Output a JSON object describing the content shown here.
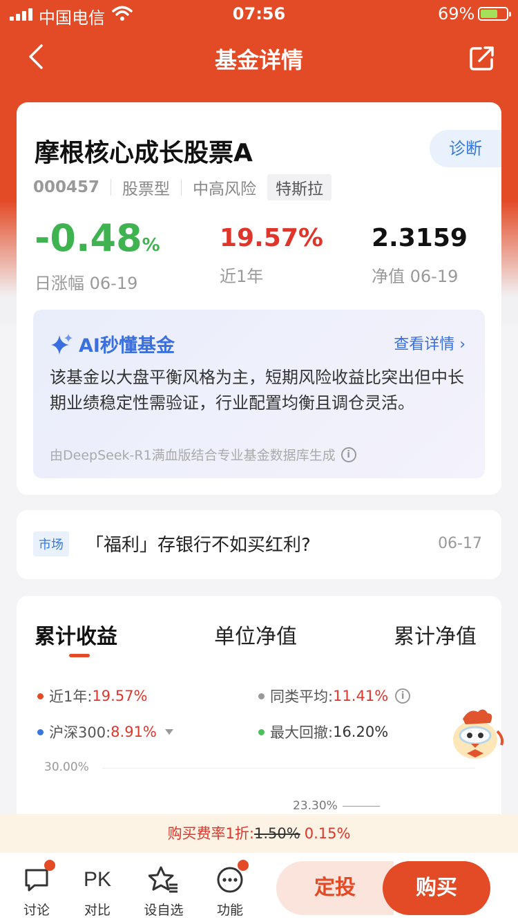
{
  "status": {
    "carrier": "中国电信",
    "time": "07:56",
    "battery": "69%"
  },
  "nav": {
    "title": "基金详情"
  },
  "fund": {
    "name": "摩根核心成长股票A",
    "diagnose": "诊断",
    "code": "000457",
    "type": "股票型",
    "risk": "中高风险",
    "tag": "特斯拉",
    "daily_change": "-0.48",
    "daily_pct_sign": "%",
    "daily_label": "日涨幅 06-19",
    "year_return": "19.57%",
    "year_label": "近1年",
    "nav_value": "2.3159",
    "nav_label": "净值 06-19"
  },
  "ai": {
    "title": "AI秒懂基金",
    "link": "查看详情 ›",
    "text": "该基金以大盘平衡风格为主，短期风险收益比突出但中长期业绩稳定性需验证，行业配置均衡且调仓灵活。",
    "source": "由DeepSeek-R1满血版结合专业基金数据库生成"
  },
  "news": {
    "tag": "市场",
    "title": "「福利」存银行不如买红利?",
    "date": "06-17"
  },
  "chart_tabs": [
    "累计收益",
    "单位净值",
    "累计净值"
  ],
  "legend": [
    {
      "label": "近1年:",
      "value": "19.57%",
      "color": "#e34a26"
    },
    {
      "label": "同类平均:",
      "value": "11.41%",
      "color": "#999999"
    },
    {
      "label": "沪深300:",
      "value": "8.91%",
      "color": "#3478e0"
    },
    {
      "label": "最大回撤:",
      "value": "16.20%",
      "color": "#4cbf5b"
    }
  ],
  "chart": {
    "y_top": "30.00%",
    "peak": "23.30%"
  },
  "fee": {
    "label": "购买费率1折:",
    "old": "1.50%",
    "new": "0.15%"
  },
  "bottom": {
    "items": [
      "讨论",
      "对比",
      "设自选",
      "功能"
    ],
    "pk": "PK",
    "dingtou": "定投",
    "buy": "购买"
  },
  "colors": {
    "brand": "#e34a26",
    "down": "#3fb34f",
    "up": "#e0352b",
    "link": "#3a6fe0"
  }
}
